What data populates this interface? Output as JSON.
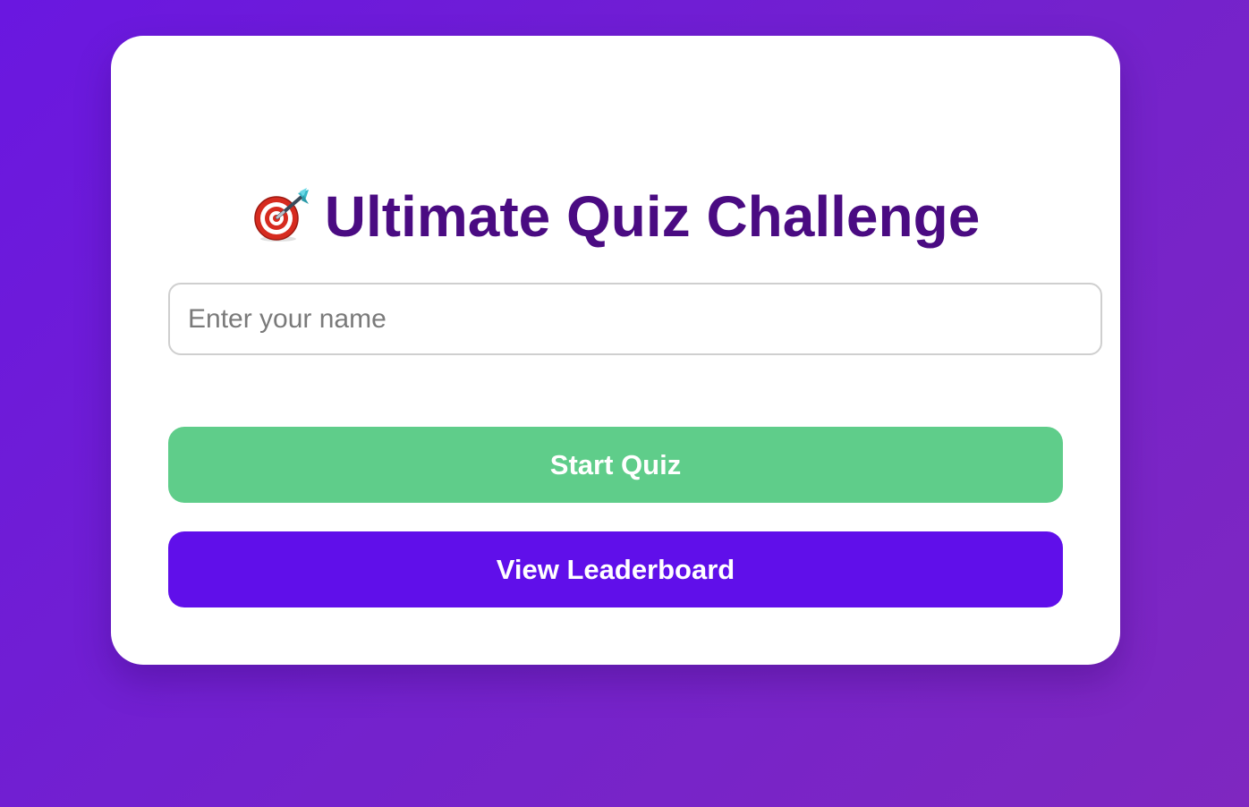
{
  "app": {
    "title": "Ultimate Quiz Challenge",
    "title_icon": "dart-target-icon"
  },
  "form": {
    "name_value": "",
    "name_placeholder": "Enter your name"
  },
  "actions": {
    "start_label": "Start Quiz",
    "leaderboard_label": "View Leaderboard"
  },
  "colors": {
    "background": "#6a17e0",
    "title": "#4a0b82",
    "start_button": "#5fcd8a",
    "leaderboard_button": "#600fea",
    "card": "#ffffff"
  }
}
